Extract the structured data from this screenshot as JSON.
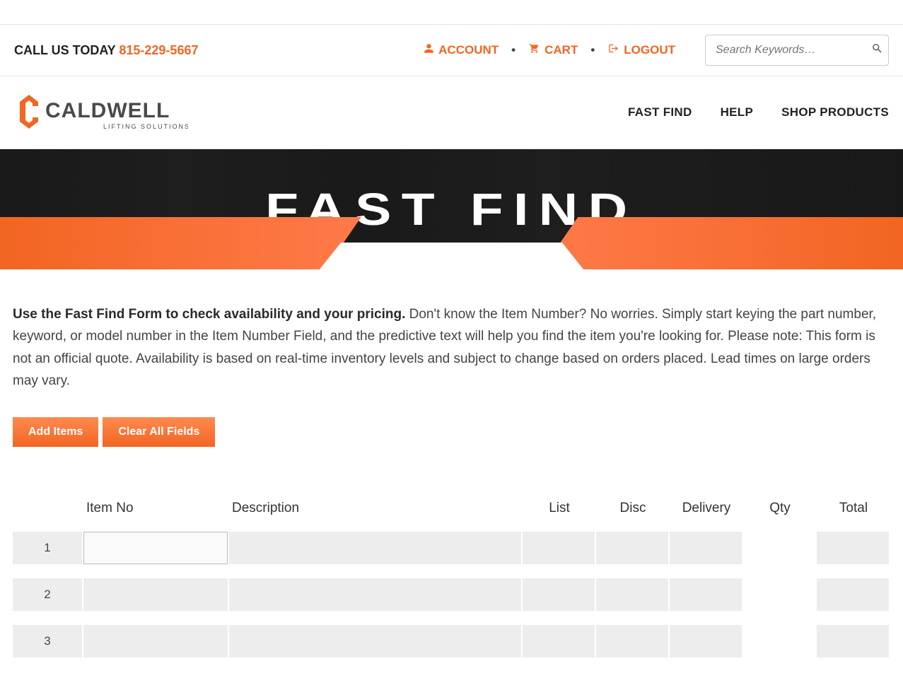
{
  "topbar": {
    "call_label": "CALL US TODAY ",
    "phone": "815-229-5667",
    "account_label": "ACCOUNT",
    "cart_label": "CART",
    "logout_label": "LOGOUT",
    "search_placeholder": "Search Keywords…"
  },
  "brand": {
    "name": "CALDWELL",
    "tagline": "LIFTING SOLUTIONS"
  },
  "nav": {
    "fast_find": "FAST FIND",
    "help": "HELP",
    "shop": "SHOP PRODUCTS"
  },
  "hero": {
    "title": "FAST FIND"
  },
  "intro": {
    "bold": "Use the Fast Find Form to check availability and your pricing.",
    "rest": " Don't know the Item Number? No worries. Simply start keying the part number, keyword, or model number in the Item Number Field, and the predictive text will help you find the item you're looking for. Please note: This form is not an official quote. Availability is based on real-time inventory levels and subject to change based on orders placed. Lead times on large orders may vary."
  },
  "buttons": {
    "add_items": "Add Items",
    "clear_all": "Clear All Fields"
  },
  "table": {
    "headers": {
      "item_no": "Item No",
      "description": "Description",
      "list": "List",
      "disc": "Disc",
      "delivery": "Delivery",
      "qty": "Qty",
      "total": "Total"
    },
    "rows": [
      {
        "num": "1",
        "item_no": "",
        "description": "",
        "list": "",
        "disc": "",
        "delivery": "",
        "qty": "",
        "total": ""
      },
      {
        "num": "2",
        "item_no": "",
        "description": "",
        "list": "",
        "disc": "",
        "delivery": "",
        "qty": "",
        "total": ""
      },
      {
        "num": "3",
        "item_no": "",
        "description": "",
        "list": "",
        "disc": "",
        "delivery": "",
        "qty": "",
        "total": ""
      }
    ]
  }
}
